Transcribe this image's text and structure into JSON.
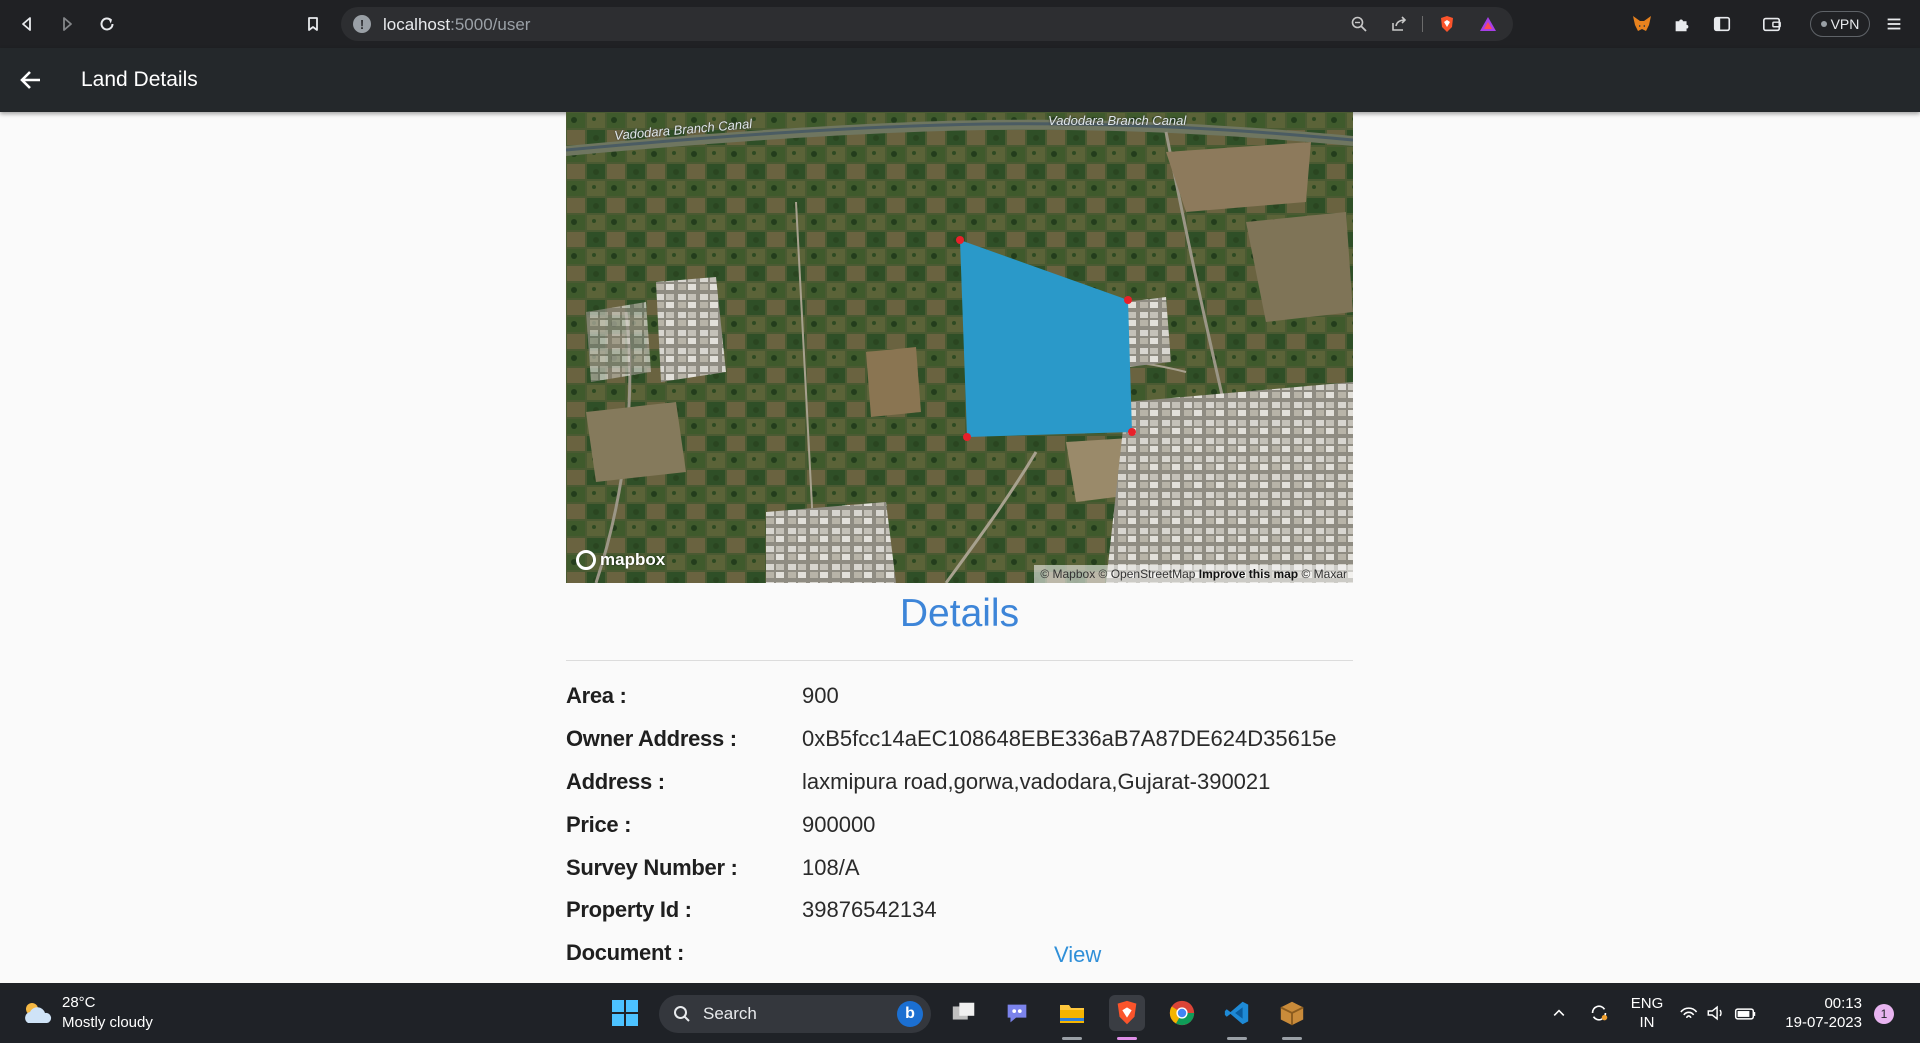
{
  "browser": {
    "url_host": "localhost",
    "url_path": ":5000/user",
    "vpn_label": "VPN"
  },
  "header": {
    "title": "Land Details"
  },
  "map": {
    "canal_label_left": "Vadodara Branch Canal",
    "canal_label_right": "Vadodara Branch Canal",
    "logo_text": "mapbox",
    "attribution": {
      "mapbox": "© Mapbox",
      "osm": "© OpenStreetMap",
      "improve": "Improve this map",
      "maxar": "© Maxar"
    },
    "parcel_color": "#2a99c9",
    "vertex_color": "#e8202a"
  },
  "details": {
    "heading": "Details",
    "rows": [
      {
        "label": "Area :",
        "value": "900"
      },
      {
        "label": "Owner Address :",
        "value": "0xB5fcc14aEC108648EBE336aB7A87DE624D35615e"
      },
      {
        "label": "Address :",
        "value": "laxmipura road,gorwa,vadodara,Gujarat-390021"
      },
      {
        "label": "Price :",
        "value": "900000"
      },
      {
        "label": "Survey Number :",
        "value": "108/A"
      },
      {
        "label": "Property Id :",
        "value": "39876542134"
      },
      {
        "label": "Document :",
        "value": ""
      }
    ],
    "document_link": "View"
  },
  "taskbar": {
    "weather_temp": "28°C",
    "weather_desc": "Mostly cloudy",
    "search_label": "Search",
    "lang_line1": "ENG",
    "lang_line2": "IN",
    "time": "00:13",
    "date": "19-07-2023",
    "notification_count": "1"
  },
  "colors": {
    "accent": "#3d85d8",
    "header_bg": "#24282b",
    "link": "#2f8fd8"
  }
}
